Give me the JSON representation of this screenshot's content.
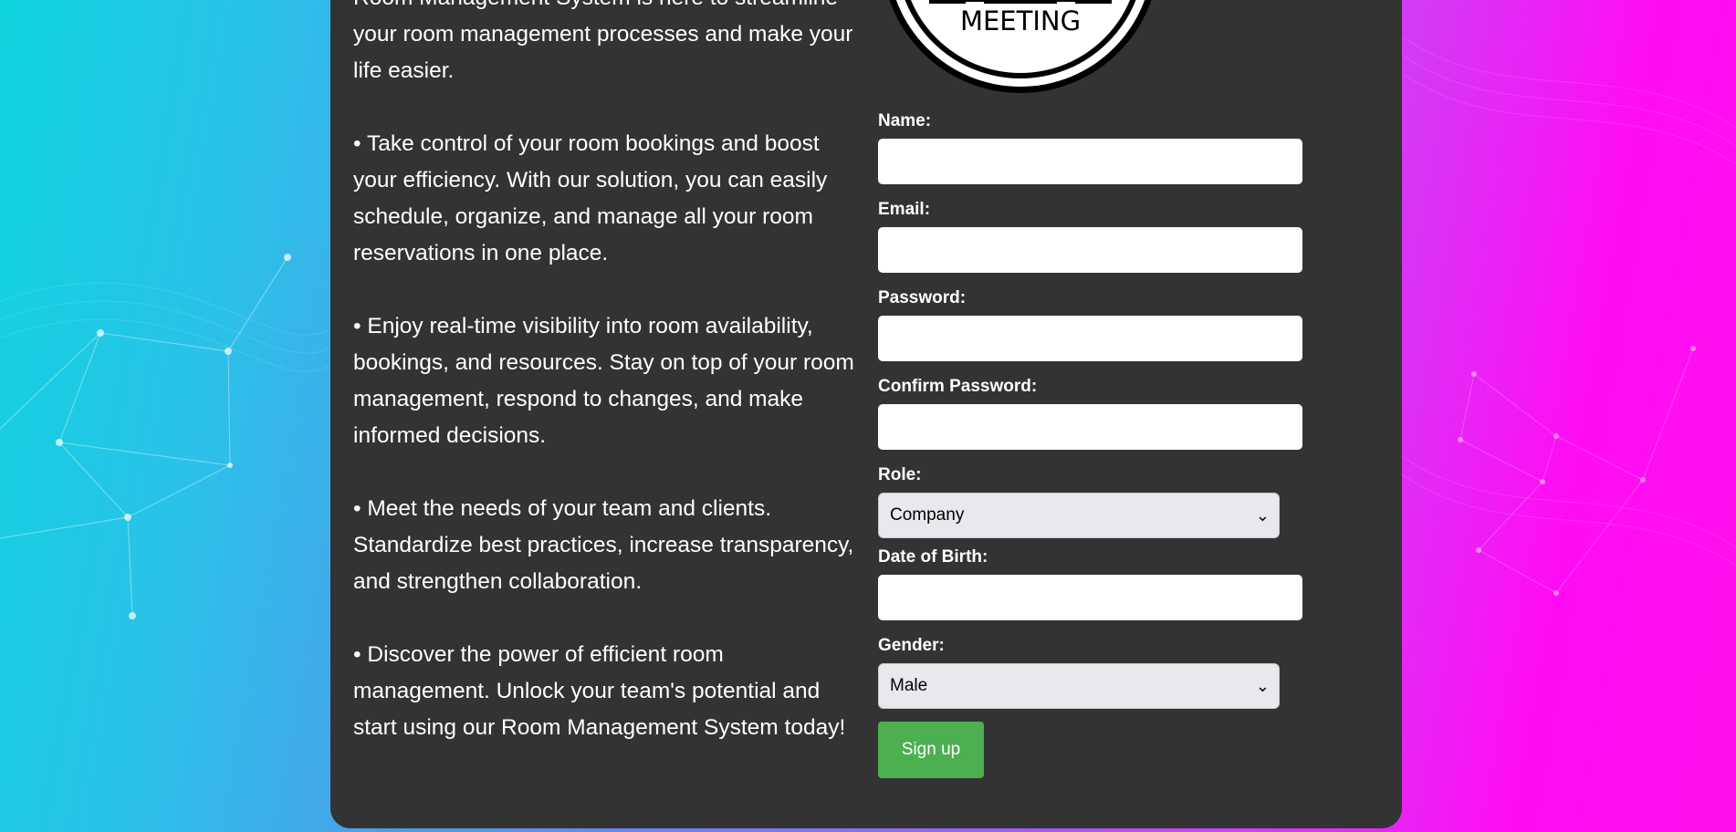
{
  "intro": {
    "paragraph_1": "Room Management System is here to streamline your room management processes and make your life easier.",
    "paragraph_2": "• Take control of your room bookings and boost your efficiency. With our solution, you can easily schedule, organize, and manage all your room reservations in one place.",
    "paragraph_3": "• Enjoy real-time visibility into room availability, bookings, and resources. Stay on top of your room management, respond to changes, and make informed decisions.",
    "paragraph_4": "• Meet the needs of your team and clients. Standardize best practices, increase transparency, and strengthen collaboration.",
    "paragraph_5": "• Discover the power of efficient room management. Unlock your team's potential and start using our Room Management System today!"
  },
  "logo": {
    "text": "MEETING"
  },
  "form": {
    "name_label": "Name:",
    "name_value": "",
    "email_label": "Email:",
    "email_value": "",
    "password_label": "Password:",
    "password_value": "",
    "confirm_password_label": "Confirm Password:",
    "confirm_password_value": "",
    "role_label": "Role:",
    "role_selected": "Company",
    "dob_label": "Date of Birth:",
    "dob_value": "",
    "gender_label": "Gender:",
    "gender_selected": "Male",
    "signup_label": "Sign up"
  },
  "colors": {
    "card_background": "#333333",
    "signup_button": "#4caf50",
    "text": "#ffffff"
  }
}
